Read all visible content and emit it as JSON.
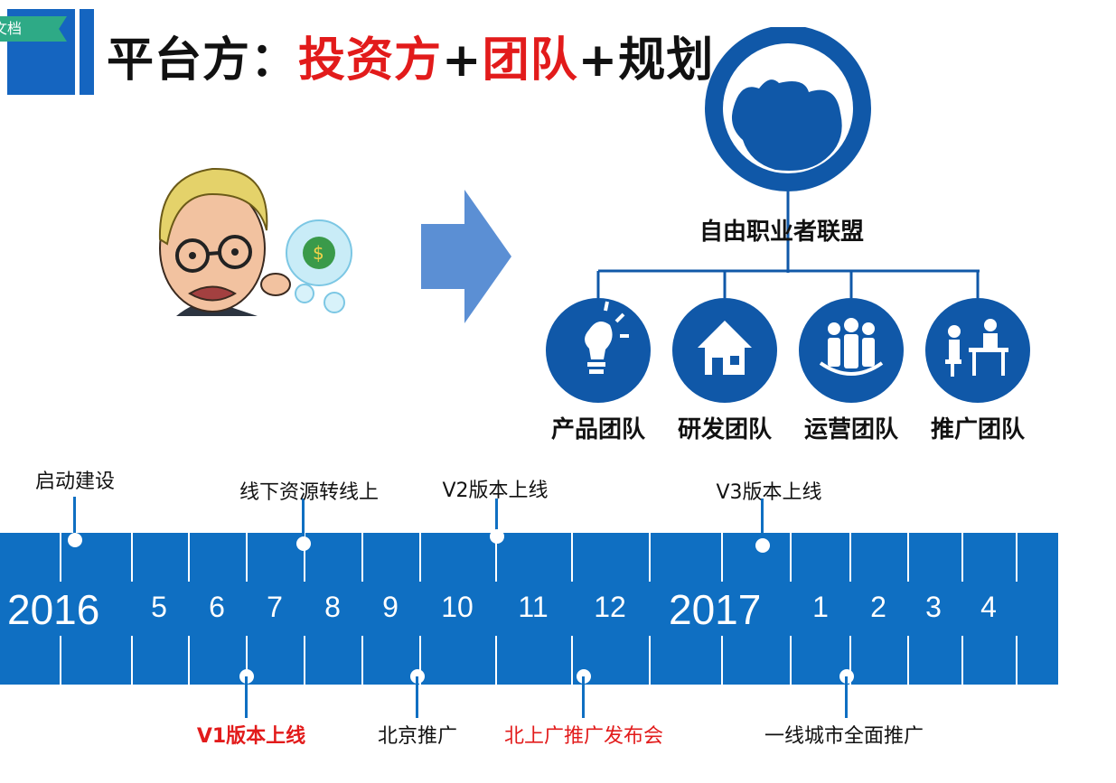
{
  "header": {
    "corner_tab": "文档",
    "title_prefix": "平台方：",
    "title_part1": "投资方",
    "title_plus1": "+",
    "title_part2": "团队",
    "title_plus2": "+",
    "title_part3": "规划"
  },
  "organization": {
    "top_label": "自由职业者联盟",
    "teams": [
      {
        "label": "产品团队",
        "icon": "lightbulb-icon"
      },
      {
        "label": "研发团队",
        "icon": "house-icon"
      },
      {
        "label": "运营团队",
        "icon": "people-group-icon"
      },
      {
        "label": "推广团队",
        "icon": "meeting-icon"
      }
    ]
  },
  "timeline": {
    "year1": "2016",
    "year2": "2017",
    "months": [
      "5",
      "6",
      "7",
      "8",
      "9",
      "10",
      "11",
      "12",
      "1",
      "2",
      "3",
      "4"
    ],
    "events_above": [
      "启动建设",
      "线下资源转线上",
      "V2版本上线",
      "V3版本上线"
    ],
    "events_below": [
      "V1版本上线",
      "北京推广",
      "北上广推广发布会",
      "一线城市全面推广"
    ]
  },
  "colors": {
    "brand_blue": "#1565c0",
    "band_blue": "#0f6fc2",
    "accent_red": "#e21b1b",
    "tab_green": "#2eaa86",
    "arrow_blue": "#5b8fd4"
  }
}
